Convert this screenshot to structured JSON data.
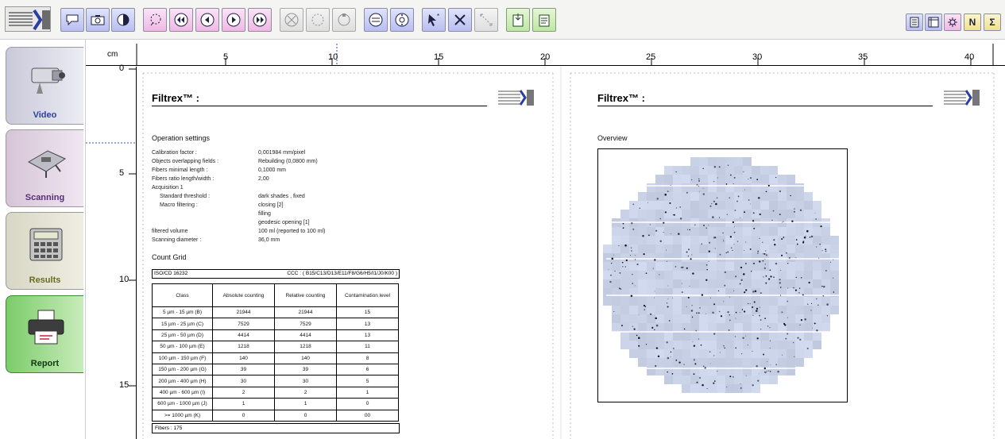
{
  "toolbar": {
    "left_buttons": [
      "comment-icon",
      "camera-icon",
      "contrast-icon",
      "lasso-icon",
      "first-icon",
      "previous-icon",
      "next-icon",
      "last-icon",
      "cancel-x-icon",
      "circle-icon",
      "rotate-icon",
      "loop-icon",
      "target-icon",
      "pointer-icon",
      "cross-icon",
      "measure-icon",
      "export-icon",
      "save-icon"
    ],
    "right_buttons": [
      "page-icon",
      "ruler-icon",
      "settings-icon",
      "N",
      "Σ"
    ]
  },
  "sidenav": {
    "tabs": [
      {
        "label": "Video",
        "icon": "video-camera-icon",
        "active": false
      },
      {
        "label": "Scanning",
        "icon": "scanner-stage-icon",
        "active": false
      },
      {
        "label": "Results",
        "icon": "calculator-icon",
        "active": false
      },
      {
        "label": "Report",
        "icon": "printer-icon",
        "active": true
      }
    ]
  },
  "ruler": {
    "unit": "cm",
    "top_ticks": [
      "5",
      "10",
      "15",
      "20",
      "25",
      "30",
      "35",
      "40"
    ],
    "left_ticks": [
      "0",
      "5",
      "10",
      "15"
    ]
  },
  "page1": {
    "title": "Filtrex™ :",
    "operation_title": "Operation settings",
    "settings": [
      {
        "label": "Calibration factor :",
        "value": "0,001984 mm/pixel"
      },
      {
        "label": "Objects overlapping fields :",
        "value": "Rebuilding (0,0800 mm)"
      },
      {
        "label": "Fibers minimal length :",
        "value": "0,1000 mm"
      },
      {
        "label": "Fibers ratio length/width :",
        "value": "2,00"
      },
      {
        "label": "Acquisition 1",
        "value": ""
      },
      {
        "label": "Standard threshold :",
        "value": "dark shades , fixed",
        "indent": true
      },
      {
        "label": "Macro filtering :",
        "value": "closing [2]",
        "indent": true
      },
      {
        "label": "",
        "value": "filling"
      },
      {
        "label": "",
        "value": "geodesic opening [1]"
      },
      {
        "label": "filtered volume",
        "value": "100 ml (reported to 100 ml)"
      },
      {
        "label": "Scanning diameter :",
        "value": "36,0 mm"
      }
    ],
    "count_title": "Count Grid",
    "grid_standard": "ISO/CD 16232",
    "grid_ccc": "CCC : ( B15/C13/D13/E11/F8/G6/H5/I1/J0/K00 )",
    "table_headers": [
      "Class",
      "Absolute counting",
      "Relative counting",
      "Contamination level"
    ],
    "table_rows": [
      [
        "5 µm - 15 µm (B)",
        "21944",
        "21944",
        "15"
      ],
      [
        "15 µm - 25 µm (C)",
        "7529",
        "7529",
        "13"
      ],
      [
        "25 µm - 50 µm (D)",
        "4414",
        "4414",
        "13"
      ],
      [
        "50 µm - 100 µm (E)",
        "1218",
        "1218",
        "11"
      ],
      [
        "100 µm - 150 µm (F)",
        "140",
        "140",
        "8"
      ],
      [
        "150 µm - 200 µm (G)",
        "39",
        "39",
        "6"
      ],
      [
        "200 µm - 400 µm (H)",
        "30",
        "30",
        "5"
      ],
      [
        "400 µm - 600 µm (I)",
        "2",
        "2",
        "1"
      ],
      [
        "600 µm - 1000 µm (J)",
        "1",
        "1",
        "0"
      ],
      [
        ">= 1000 µm (K)",
        "0",
        "0",
        "00"
      ]
    ],
    "fibers": "Fibers : 175"
  },
  "page2": {
    "title": "Filtrex™ :",
    "overview_title": "Overview"
  }
}
